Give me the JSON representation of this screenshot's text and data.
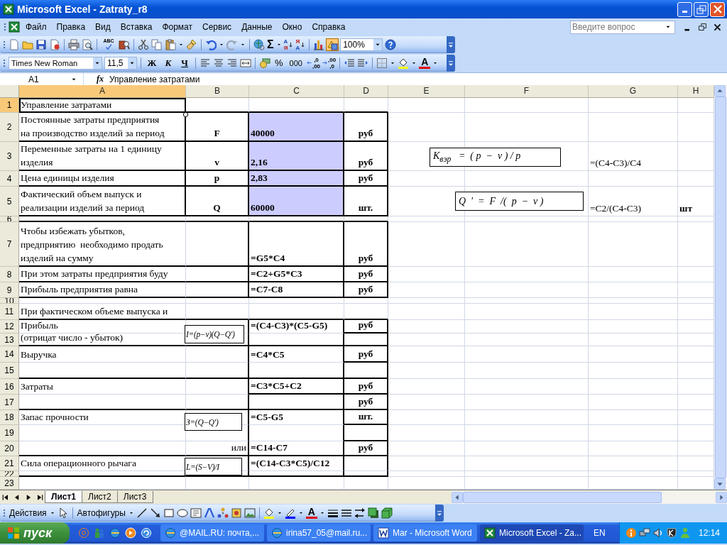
{
  "window": {
    "title": "Microsoft Excel - Zatraty_r8"
  },
  "menu": [
    "Файл",
    "Правка",
    "Вид",
    "Вставка",
    "Формат",
    "Сервис",
    "Данные",
    "Окно",
    "Справка"
  ],
  "help_box": {
    "placeholder": "Введите вопрос"
  },
  "standard_toolbar": {
    "spelling": "ABC",
    "sum": "Σ",
    "sort_buttons": [
      {
        "top": "А",
        "bottom": "Я"
      },
      {
        "top": "Я",
        "bottom": "А"
      }
    ],
    "zoom": "100%"
  },
  "format_toolbar": {
    "font": "Times New Roman",
    "size": "11,5",
    "styles": [
      "Ж",
      "К",
      "Ч"
    ],
    "percent": "%",
    "thousands": "000",
    "decimal_buttons": [
      {
        "top": ",0",
        "bottom": ",00"
      },
      {
        "top": ",00",
        "bottom": ",0"
      }
    ],
    "font_color": "A"
  },
  "formula_bar": {
    "name_box": "A1",
    "fx": "fx",
    "content": "Управление затратами"
  },
  "columns": [
    {
      "label": "A",
      "selected": true
    },
    {
      "label": "B",
      "selected": false
    },
    {
      "label": "C",
      "selected": false
    },
    {
      "label": "D",
      "selected": false
    },
    {
      "label": "E",
      "selected": false
    },
    {
      "label": "F",
      "selected": false
    },
    {
      "label": "G",
      "selected": false
    },
    {
      "label": "H",
      "selected": false
    }
  ],
  "rows": [
    {
      "number": "1",
      "selected": true,
      "cells": {
        "A": {
          "text": "Управление затратами",
          "shaded": false
        }
      }
    },
    {
      "number": "2",
      "selected": false,
      "cells": {
        "A": {
          "text": "Постоянные затраты предприятия\nна производство изделий за период",
          "shaded": false
        },
        "B": {
          "text": "F",
          "shaded": false
        },
        "C": {
          "text": "40000",
          "shaded": true
        },
        "D": {
          "text": "руб",
          "shaded": false
        }
      }
    },
    {
      "number": "3",
      "selected": false,
      "cells": {
        "A": {
          "text": "Переменные затраты на 1 единицу\nизделия",
          "shaded": false
        },
        "B": {
          "text": "v",
          "shaded": false
        },
        "C": {
          "text": "2,16",
          "shaded": true
        },
        "D": {
          "text": "руб",
          "shaded": false
        },
        "G": {
          "text": "=(C4-C3)/C4",
          "shaded": false
        }
      }
    },
    {
      "number": "4",
      "selected": false,
      "cells": {
        "A": {
          "text": "Цена единицы изделия",
          "shaded": false
        },
        "B": {
          "text": "p",
          "shaded": false
        },
        "C": {
          "text": "2,83",
          "shaded": true
        },
        "D": {
          "text": "руб",
          "shaded": false
        }
      }
    },
    {
      "number": "5",
      "selected": false,
      "cells": {
        "A": {
          "text": "Фактический объем выпуск и\nреализации изделий за период",
          "shaded": false
        },
        "B": {
          "text": "Q",
          "shaded": false
        },
        "C": {
          "text": "60000",
          "shaded": true
        },
        "D": {
          "text": "шт.",
          "shaded": false
        },
        "G": {
          "text": "=C2/(C4-C3)",
          "shaded": false
        },
        "H": {
          "text": "шт",
          "shaded": false
        }
      }
    },
    {
      "number": "6",
      "selected": false,
      "cells": {}
    },
    {
      "number": "7",
      "selected": false,
      "cells": {
        "A": {
          "text": "Чтобы избежать убытков,\nпредприятию  необходимо продать\nизделий на сумму",
          "shaded": false
        },
        "C": {
          "text": "=G5*C4",
          "shaded": false
        },
        "D": {
          "text": "руб",
          "shaded": false
        }
      }
    },
    {
      "number": "8",
      "selected": false,
      "cells": {
        "A": {
          "text": "При этом затраты предприятия буду",
          "shaded": false
        },
        "C": {
          "text": "=C2+G5*C3",
          "shaded": false
        },
        "D": {
          "text": "руб",
          "shaded": false
        }
      }
    },
    {
      "number": "9",
      "selected": false,
      "cells": {
        "A": {
          "text": "Прибыль предприятия равна",
          "shaded": false
        },
        "C": {
          "text": "=C7-C8",
          "shaded": false
        },
        "D": {
          "text": "руб",
          "shaded": false
        }
      }
    },
    {
      "number": "10",
      "selected": false,
      "cells": {}
    },
    {
      "number": "11",
      "selected": false,
      "cells": {
        "A": {
          "text": "При фактическом объеме выпуска и",
          "shaded": false
        }
      }
    },
    {
      "number": "12",
      "selected": false,
      "cells": {
        "A": {
          "text": "Прибыль",
          "shaded": false
        },
        "C": {
          "text": "=(C4-C3)*(C5-G5)",
          "shaded": false
        },
        "D": {
          "text": "руб",
          "shaded": false
        }
      }
    },
    {
      "number": "13",
      "selected": false,
      "cells": {
        "A": {
          "text": "(отрицат число - убыток)",
          "shaded": false
        }
      }
    },
    {
      "number": "14",
      "selected": false,
      "cells": {
        "A": {
          "text": "Выручка",
          "shaded": false
        },
        "C": {
          "text": "=C4*C5",
          "shaded": false
        },
        "D": {
          "text": "руб",
          "shaded": false
        }
      }
    },
    {
      "number": "15",
      "selected": false,
      "cells": {}
    },
    {
      "number": "16",
      "selected": false,
      "cells": {
        "A": {
          "text": "Затраты",
          "shaded": false
        },
        "C": {
          "text": "=C3*C5+C2",
          "shaded": false
        },
        "D": {
          "text": "руб",
          "shaded": false
        }
      }
    },
    {
      "number": "17",
      "selected": false,
      "cells": {
        "D": {
          "text": "руб",
          "shaded": false
        }
      }
    },
    {
      "number": "18",
      "selected": false,
      "cells": {
        "A": {
          "text": "Запас прочности",
          "shaded": false
        },
        "C": {
          "text": "=C5-G5",
          "shaded": false
        },
        "D": {
          "text": "шт.",
          "shaded": false
        }
      }
    },
    {
      "number": "19",
      "selected": false,
      "cells": {}
    },
    {
      "number": "20",
      "selected": false,
      "cells": {
        "B": {
          "text": "или",
          "shaded": false,
          "right_aligned": true
        },
        "C": {
          "text": "=C14-C7",
          "shaded": false
        },
        "D": {
          "text": "руб",
          "shaded": false
        }
      }
    },
    {
      "number": "21",
      "selected": false,
      "cells": {
        "A": {
          "text": "Сила операционного рычага",
          "shaded": false
        },
        "C": {
          "text": "=(C14-C3*C5)/C12",
          "shaded": false
        }
      }
    },
    {
      "number": "22",
      "selected": false,
      "cells": {}
    },
    {
      "number": "23",
      "selected": false,
      "cells": {}
    }
  ],
  "formula_boxes": [
    "K$_{вэр}$   =  ( p  −  v ) / p",
    "Q  '  =  F  /(  p  −  v )",
    "I=(p−v)(Q−Q')",
    "З=(Q−Q')",
    "L=(S−V)/I"
  ],
  "sheet_tabs": [
    {
      "label": "Лист1",
      "selected": true
    },
    {
      "label": "Лист2",
      "selected": false
    },
    {
      "label": "Лист3",
      "selected": false
    }
  ],
  "drawing_toolbar": {
    "actions": "Действия",
    "autoshapes": "Автофигуры",
    "font_color": "A"
  },
  "taskbar": {
    "start": "пуск",
    "tasks": [
      {
        "label": "@MAIL.RU: почта,...",
        "kind": "browser",
        "selected": false
      },
      {
        "label": "irina57_05@mail.ru...",
        "kind": "browser",
        "selected": false
      },
      {
        "label": "Mar - Microsoft Word",
        "kind": "word",
        "selected": false
      },
      {
        "label": "Microsoft Excel - Za...",
        "kind": "excel",
        "selected": true
      }
    ],
    "language": "EN",
    "clock": "12:14"
  }
}
